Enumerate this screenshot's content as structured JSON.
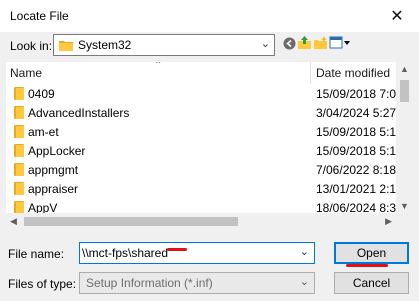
{
  "window": {
    "title": "Locate File",
    "close_glyph": "✕"
  },
  "lookin": {
    "label": "Look in:",
    "value": "System32"
  },
  "toolbar": {
    "icons": [
      "back-icon",
      "up-folder-icon",
      "new-folder-icon",
      "view-menu-icon"
    ]
  },
  "filelist": {
    "columns": {
      "name": "Name",
      "date": "Date modified"
    },
    "rows": [
      {
        "name": "0409",
        "date": "15/09/2018 7:0"
      },
      {
        "name": "AdvancedInstallers",
        "date": "3/04/2024 5:27"
      },
      {
        "name": "am-et",
        "date": "15/09/2018 5:1"
      },
      {
        "name": "AppLocker",
        "date": "15/09/2018 5:1"
      },
      {
        "name": "appmgmt",
        "date": "7/06/2022 8:18"
      },
      {
        "name": "appraiser",
        "date": "13/01/2021 2:1"
      },
      {
        "name": "AppV",
        "date": "18/06/2024 8:3"
      }
    ]
  },
  "filename": {
    "label": "File name:",
    "value": "\\\\mct-fps\\shared"
  },
  "filetype": {
    "label": "Files of type:",
    "value": "Setup Information (*.inf)"
  },
  "buttons": {
    "open": "Open",
    "cancel": "Cancel"
  },
  "colors": {
    "accent": "#0078d7",
    "annotation": "#e0101a",
    "folder": "#ffc83d"
  }
}
